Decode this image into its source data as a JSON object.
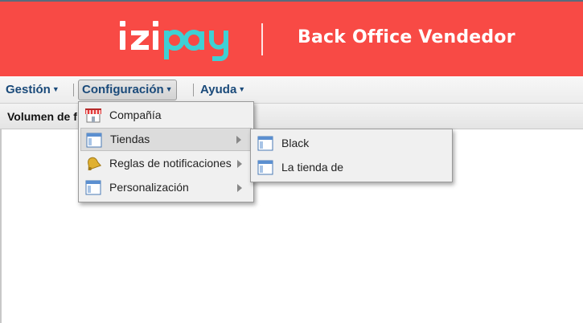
{
  "header": {
    "brand": "izipay",
    "title": "Back Office Vendedor",
    "brand_colors": {
      "background": "#f84a45",
      "logo_dark": "#ffffff",
      "logo_accent": "#3fd0d4"
    }
  },
  "menubar": {
    "items": [
      {
        "label": "Gestión"
      },
      {
        "label": "Configuración"
      },
      {
        "label": "Ayuda"
      }
    ]
  },
  "tab": {
    "title": "Volumen de f"
  },
  "config_menu": {
    "items": [
      {
        "label": "Compañía",
        "icon": "shop-icon"
      },
      {
        "label": "Tiendas",
        "icon": "window-icon",
        "submenu": true
      },
      {
        "label": "Reglas de notificaciones",
        "icon": "bell-icon",
        "submenu": true
      },
      {
        "label": "Personalización",
        "icon": "window-icon",
        "submenu": true
      }
    ]
  },
  "tiendas_submenu": {
    "items": [
      {
        "label": "Black",
        "icon": "window-icon"
      },
      {
        "label": "La tienda de",
        "icon": "window-icon"
      }
    ]
  }
}
